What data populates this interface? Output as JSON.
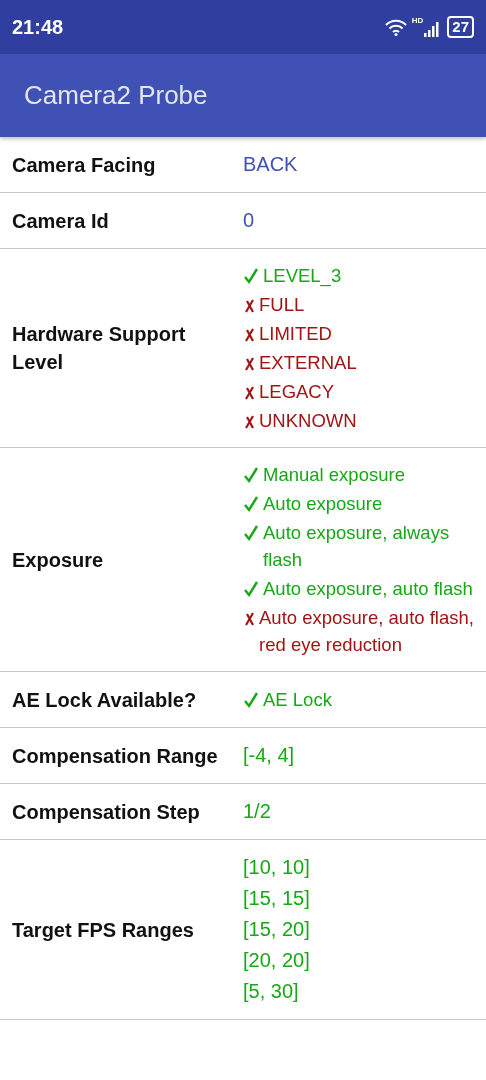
{
  "status_bar": {
    "time": "21:48",
    "network": "HD",
    "battery": "27"
  },
  "app_bar": {
    "title": "Camera2 Probe"
  },
  "rows": [
    {
      "label": "Camera Facing",
      "kind": "info",
      "values": [
        "BACK"
      ]
    },
    {
      "label": "Camera Id",
      "kind": "info",
      "values": [
        "0"
      ]
    },
    {
      "label": "Hardware Support Level",
      "kind": "checks",
      "items": [
        {
          "text": "LEVEL_3",
          "supported": true
        },
        {
          "text": "FULL",
          "supported": false
        },
        {
          "text": "LIMITED",
          "supported": false
        },
        {
          "text": "EXTERNAL",
          "supported": false
        },
        {
          "text": "LEGACY",
          "supported": false
        },
        {
          "text": "UNKNOWN",
          "supported": false
        }
      ]
    },
    {
      "label": "Exposure",
      "kind": "checks",
      "items": [
        {
          "text": "Manual exposure",
          "supported": true
        },
        {
          "text": "Auto exposure",
          "supported": true
        },
        {
          "text": "Auto exposure, always flash",
          "supported": true
        },
        {
          "text": "Auto exposure, auto flash",
          "supported": true
        },
        {
          "text": "Auto exposure, auto flash, red eye reduction",
          "supported": false
        }
      ]
    },
    {
      "label": "AE Lock Available?",
      "kind": "checks",
      "items": [
        {
          "text": "AE Lock",
          "supported": true
        }
      ]
    },
    {
      "label": "Compensation Range",
      "kind": "lines",
      "values": [
        "[-4, 4]"
      ]
    },
    {
      "label": "Compensation Step",
      "kind": "lines",
      "values": [
        "1/2"
      ]
    },
    {
      "label": "Target FPS Ranges",
      "kind": "lines",
      "values": [
        "[10, 10]",
        "[15, 15]",
        "[15, 20]",
        "[20, 20]",
        "[5, 30]"
      ]
    }
  ]
}
